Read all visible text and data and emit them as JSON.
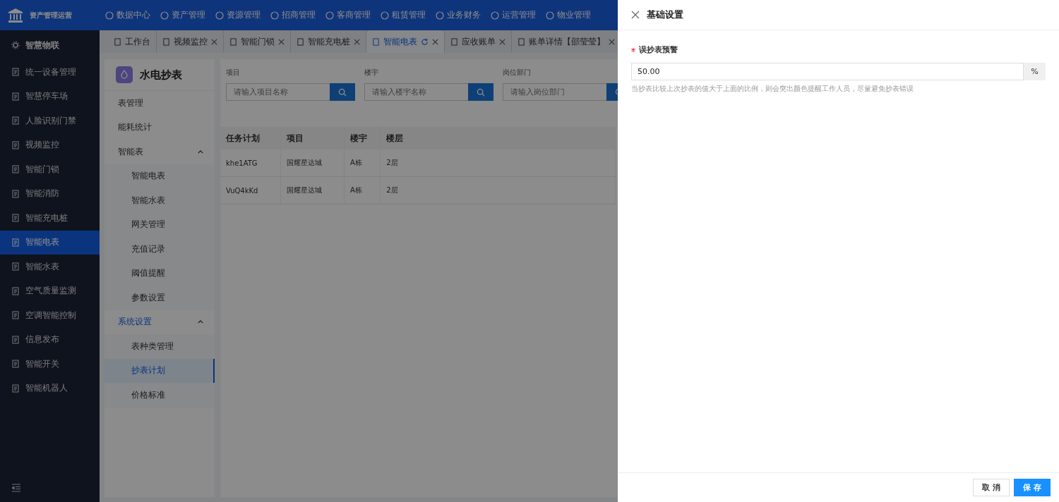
{
  "app": {
    "title": "资产管理运营"
  },
  "top_nav": [
    {
      "label": "数据中心"
    },
    {
      "label": "资产管理"
    },
    {
      "label": "资源管理"
    },
    {
      "label": "招商管理"
    },
    {
      "label": "客商管理"
    },
    {
      "label": "租赁管理"
    },
    {
      "label": "业务财务"
    },
    {
      "label": "运营管理"
    },
    {
      "label": "物业管理"
    }
  ],
  "tabs": [
    {
      "label": "工作台",
      "selected": false,
      "closable": false
    },
    {
      "label": "视频监控",
      "selected": false,
      "closable": true
    },
    {
      "label": "智能门锁",
      "selected": false,
      "closable": true
    },
    {
      "label": "智能充电桩",
      "selected": false,
      "closable": true
    },
    {
      "label": "智能电表",
      "selected": true,
      "closable": true
    },
    {
      "label": "应收账单",
      "selected": false,
      "closable": true
    },
    {
      "label": "账单详情【邵莹莹】",
      "selected": false,
      "closable": true
    }
  ],
  "sidebar": {
    "header": "智慧物联",
    "items": [
      {
        "label": "统一设备管理",
        "selected": false
      },
      {
        "label": "智慧停车场",
        "selected": false
      },
      {
        "label": "人脸识别门禁",
        "selected": false
      },
      {
        "label": "视频监控",
        "selected": false
      },
      {
        "label": "智能门锁",
        "selected": false
      },
      {
        "label": "智能消防",
        "selected": false
      },
      {
        "label": "智能充电桩",
        "selected": false
      },
      {
        "label": "智能电表",
        "selected": true
      },
      {
        "label": "智能水表",
        "selected": false
      },
      {
        "label": "空气质量监测",
        "selected": false
      },
      {
        "label": "空调智能控制",
        "selected": false
      },
      {
        "label": "信息发布",
        "selected": false
      },
      {
        "label": "智能开关",
        "selected": false
      },
      {
        "label": "智能机器人",
        "selected": false
      }
    ]
  },
  "submenu": {
    "title": "水电抄表",
    "items": [
      {
        "label": "表管理",
        "selected": false
      },
      {
        "label": "能耗统计",
        "selected": false
      },
      {
        "label": "智能表",
        "selected": false,
        "expanded": true,
        "children": [
          {
            "label": "智能电表",
            "selected": false
          },
          {
            "label": "智能水表",
            "selected": false
          },
          {
            "label": "网关管理",
            "selected": false
          },
          {
            "label": "充值记录",
            "selected": false
          },
          {
            "label": "阈值提醒",
            "selected": false
          },
          {
            "label": "参数设置",
            "selected": false
          }
        ]
      },
      {
        "label": "系统设置",
        "selected": true,
        "expanded": true,
        "children": [
          {
            "label": "表种类管理",
            "selected": false
          },
          {
            "label": "抄表计划",
            "selected": true
          },
          {
            "label": "价格标准",
            "selected": false
          }
        ]
      }
    ]
  },
  "filters": [
    {
      "label": "项目",
      "placeholder": "请输入项目名称"
    },
    {
      "label": "楼宇",
      "placeholder": "请输入楼宇名称"
    },
    {
      "label": "岗位部门",
      "placeholder": "请输入岗位部门"
    }
  ],
  "table": {
    "columns": [
      "任务计划",
      "项目",
      "楼宇",
      "楼层"
    ],
    "rows": [
      [
        "khe1ATG",
        "国耀星达城",
        "A栋",
        "2层"
      ],
      [
        "VuQ4kKd",
        "国耀星达城",
        "A栋",
        "2层"
      ]
    ]
  },
  "drawer": {
    "title": "基础设置",
    "field": {
      "label": "误抄表预警",
      "required": true,
      "value": "50.00",
      "suffix": "%",
      "hint": "当抄表比较上次抄表的值大于上面的比例，则会突出颜色提醒工作人员，尽量避免抄表错误"
    },
    "buttons": [
      {
        "label": "取 消",
        "kind": "default"
      },
      {
        "label": "保 存",
        "kind": "primary"
      }
    ]
  }
}
